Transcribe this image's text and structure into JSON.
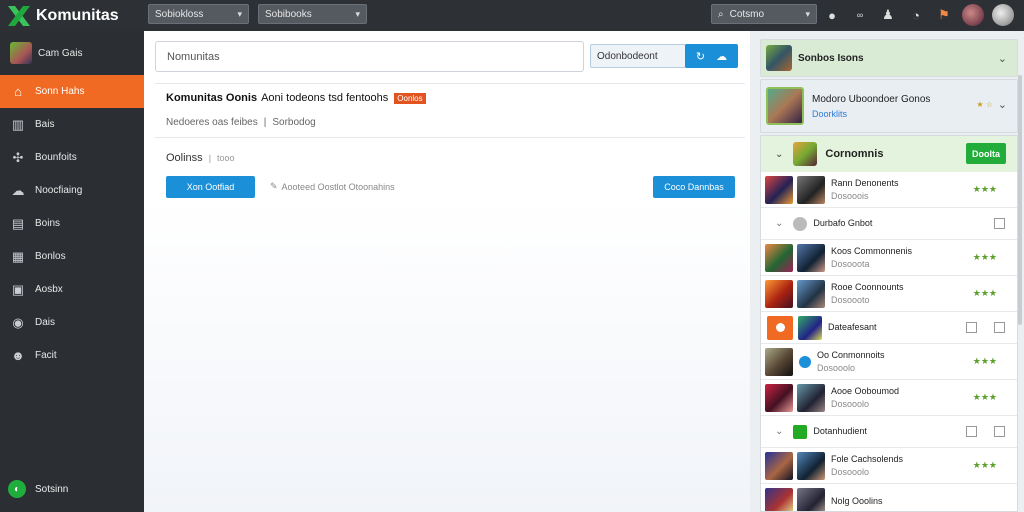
{
  "app": {
    "name": "Komunitas"
  },
  "topbar": {
    "select1": "Sobiokloss",
    "select2": "Sobibooks",
    "search_select": "Cotsmo"
  },
  "sidebar": {
    "user": "Cam Gais",
    "items": [
      {
        "label": "Sonn Hahs",
        "icon": "home-icon"
      },
      {
        "label": "Bais",
        "icon": "chart-icon"
      },
      {
        "label": "Bounfoits",
        "icon": "puzzle-icon"
      },
      {
        "label": "Noocfiaing",
        "icon": "cloud-icon"
      },
      {
        "label": "Boins",
        "icon": "box-icon"
      },
      {
        "label": "Bonlos",
        "icon": "grid-icon"
      },
      {
        "label": "Aosbx",
        "icon": "inbox-icon"
      },
      {
        "label": "Dais",
        "icon": "target-icon"
      },
      {
        "label": "Facit",
        "icon": "face-icon"
      }
    ],
    "bottom_label": "Sotsinn"
  },
  "main": {
    "search_placeholder": "Nomunitas",
    "sort_label": "Odonbodeont",
    "title_bold": "Komunitas Oonis",
    "title_rest": "Aoni todeons tsd fentoohs",
    "title_badge": "Oonlos",
    "sub1": "Nedoeres oas feibes",
    "sub_sep": "|",
    "sub2": "Sorbodog",
    "options_label": "Oolinss",
    "options_sep": "|",
    "options_extra": "tooo",
    "new_button": "Xon Ootfiad",
    "link_text": "Aooteed Oostlot Otoonahins",
    "right_button": "Coco Dannbas"
  },
  "right_panel": {
    "header": "Sonbos Isons",
    "featured_title": "Modoro Uboondoer Gonos",
    "featured_sub": "Doorklits",
    "featured_score": "★ ☆",
    "list_title": "Cornomnis",
    "list_button": "Doolta",
    "rows": [
      {
        "title": "Rann Denonents",
        "sub": "Dosooois",
        "stars": "★★★",
        "kind": "full"
      },
      {
        "title": "Durbafo Gnbot",
        "kind": "mini"
      },
      {
        "title": "Koos Commonnenis",
        "sub": "Dosooota",
        "stars": "★★★",
        "kind": "full"
      },
      {
        "title": "Rooe Coonnounts",
        "sub": "Dosoooto",
        "stars": "★★★",
        "kind": "full"
      },
      {
        "title": "Dateafesant",
        "kind": "mini"
      },
      {
        "title": "Oo Conmonnoits",
        "sub": "Dosooolo",
        "stars": "★★★",
        "kind": "full"
      },
      {
        "title": "Aooe Ooboumod",
        "sub": "Dosooolo",
        "stars": "★★★",
        "kind": "full"
      },
      {
        "title": "Dotanhudient",
        "kind": "mini"
      },
      {
        "title": "Fole Cachsolends",
        "sub": "Dosooolo",
        "stars": "★★★",
        "kind": "full"
      },
      {
        "title": "Nolg Ooolins",
        "sub": "",
        "stars": "",
        "kind": "full"
      }
    ]
  },
  "colors": {
    "accent": "#f06a23",
    "primary": "#1b8fd8",
    "success": "#22ad3a",
    "sidebar": "#2b2e33"
  }
}
